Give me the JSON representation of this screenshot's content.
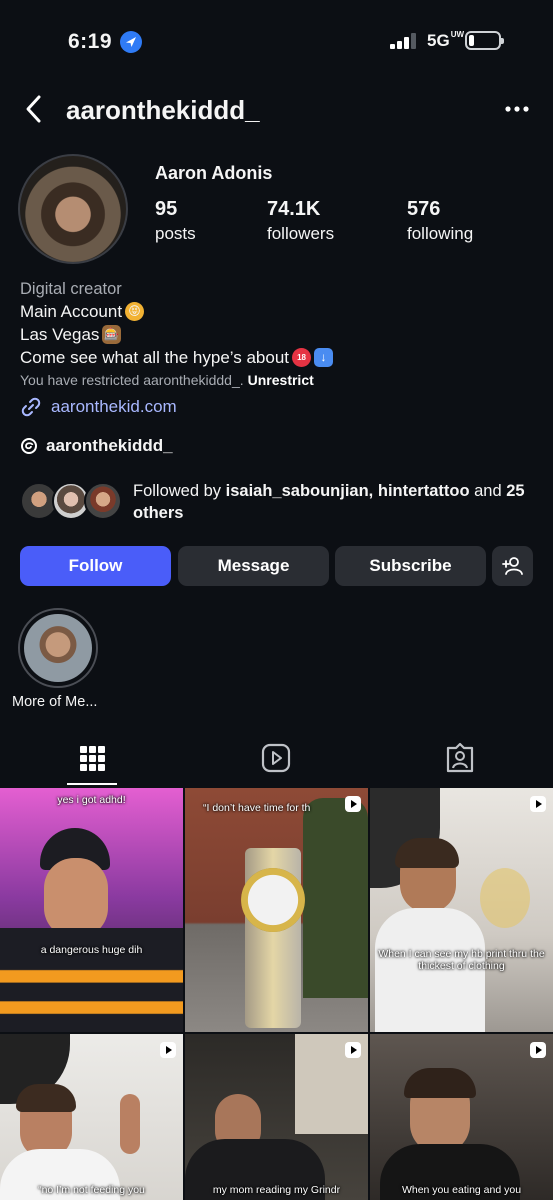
{
  "status_bar": {
    "time": "6:19",
    "network": "5G",
    "network_sub": "UW"
  },
  "header": {
    "username": "aaronthekiddd_"
  },
  "profile": {
    "full_name": "Aaron Adonis",
    "stats": [
      {
        "value": "95",
        "label": "posts"
      },
      {
        "value": "74.1K",
        "label": "followers"
      },
      {
        "value": "576",
        "label": "following"
      }
    ],
    "category": "Digital creator",
    "bio_lines": [
      "Main Account",
      "Las Vegas",
      "Come see what all the hype’s about"
    ],
    "restricted_text": "You have restricted aaronthekiddd_.",
    "unrestrict_label": "Unrestrict",
    "link": "aaronthekid.com",
    "threads_handle": "aaronthekiddd_",
    "followed_by": {
      "prefix": "Followed by",
      "users": [
        "isaiah_sabounjian,",
        "hintertattoo"
      ],
      "connector": "and",
      "others": "25 others"
    }
  },
  "actions": {
    "follow": "Follow",
    "message": "Message",
    "subscribe": "Subscribe"
  },
  "highlights": [
    {
      "label": "More of Me..."
    }
  ],
  "tabs": [
    {
      "icon": "grid-icon",
      "active": true
    },
    {
      "icon": "reels-icon"
    },
    {
      "icon": "tagged-icon"
    }
  ],
  "grid": [
    {
      "caption": "yes i got adhd!"
    },
    {
      "caption": "“I don’t have time for th"
    },
    {
      "caption": ""
    },
    {
      "caption": "a dangerous huge dih"
    },
    {
      "caption": ""
    },
    {
      "caption": "When I can see my hb print thru the thickest of clothing"
    },
    {
      "caption": "“no I’m not feeding you"
    },
    {
      "caption": "my mom reading my Grindr"
    },
    {
      "caption": "When you eating and you"
    }
  ],
  "colors": {
    "background": "#0c0f14",
    "follow_button": "#4a5df9",
    "secondary_button": "#2a2d33",
    "link": "#a9b8ff",
    "location_icon": "#2f7bf6"
  }
}
